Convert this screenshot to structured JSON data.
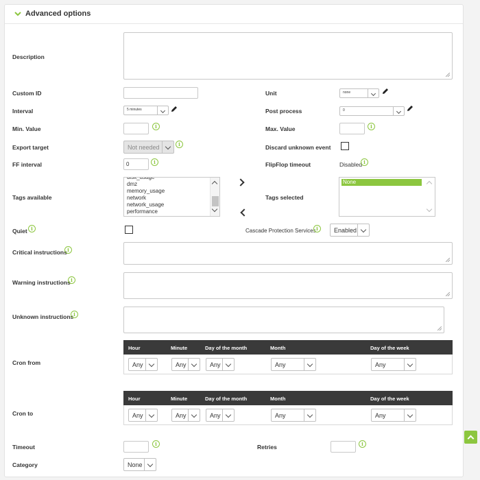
{
  "header": {
    "title": "Advanced options"
  },
  "labels": {
    "description": "Description",
    "custom_id": "Custom ID",
    "unit": "Unit",
    "interval": "Interval",
    "post_process": "Post process",
    "min_value": "Min. Value",
    "max_value": "Max. Value",
    "export_target": "Export target",
    "discard_unknown": "Discard unknown event",
    "ff_interval": "FF interval",
    "flipflop_timeout": "FlipFlop timeout",
    "tags_available": "Tags available",
    "tags_selected": "Tags selected",
    "quiet": "Quiet",
    "cascade": "Cascade Protection Services",
    "critical": "Critical instructions",
    "warning": "Warning instructions",
    "unknown": "Unknown instructions",
    "cron_from": "Cron from",
    "cron_to": "Cron to",
    "timeout": "Timeout",
    "retries": "Retries",
    "category": "Category"
  },
  "values": {
    "unit": "none",
    "interval": "5 minutes",
    "post_process": "0",
    "export_target": "Not needed",
    "ff_interval": "0",
    "flipflop_timeout": "Disabled",
    "cascade": "Enabled",
    "category": "None"
  },
  "tags_available": [
    "disk_usage",
    "dmz",
    "memory_usage",
    "network",
    "network_usage",
    "performance"
  ],
  "tags_selected": [
    "None"
  ],
  "cron": {
    "headers": {
      "hour": "Hour",
      "minute": "Minute",
      "dom": "Day of the month",
      "month": "Month",
      "dow": "Day of the week"
    },
    "any": "Any"
  },
  "info_glyph": "i",
  "colors": {
    "accent": "#8cc63f",
    "cron_header": "#3a3a3a"
  }
}
